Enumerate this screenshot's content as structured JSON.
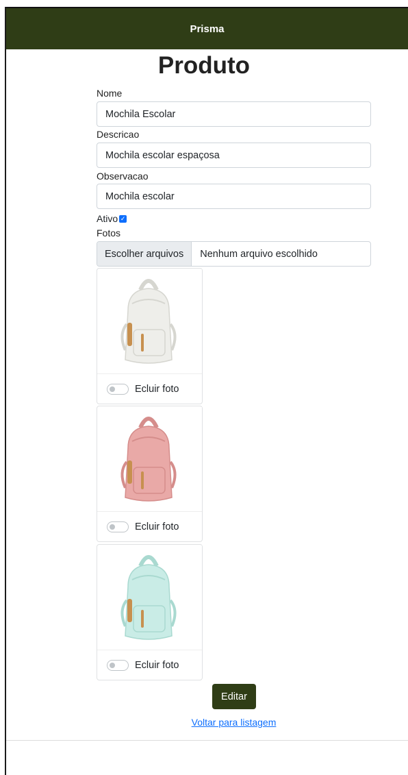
{
  "navbar": {
    "brand": "Prisma"
  },
  "page": {
    "title": "Produto"
  },
  "form": {
    "nome": {
      "label": "Nome",
      "value": "Mochila Escolar"
    },
    "descricao": {
      "label": "Descricao",
      "value": "Mochila escolar espaçosa"
    },
    "observacao": {
      "label": "Observacao",
      "value": "Mochila escolar"
    },
    "ativo": {
      "label": "Ativo",
      "checked": true
    },
    "fotos": {
      "label": "Fotos",
      "button_label": "Escolher arquivos",
      "status": "Nenhum arquivo escolhido"
    }
  },
  "photos": [
    {
      "color": "#eeeeea",
      "shade": "#d6d6d0",
      "strap": "#c7904f",
      "toggle_label": "Ecluir foto",
      "toggle_on": false
    },
    {
      "color": "#e9a9a7",
      "shade": "#d58d8b",
      "strap": "#c7904f",
      "toggle_label": "Ecluir foto",
      "toggle_on": false
    },
    {
      "color": "#c9ece6",
      "shade": "#a9d9d0",
      "strap": "#c7904f",
      "toggle_label": "Ecluir foto",
      "toggle_on": false
    }
  ],
  "actions": {
    "edit_label": "Editar",
    "back_link": "Voltar para listagem"
  }
}
